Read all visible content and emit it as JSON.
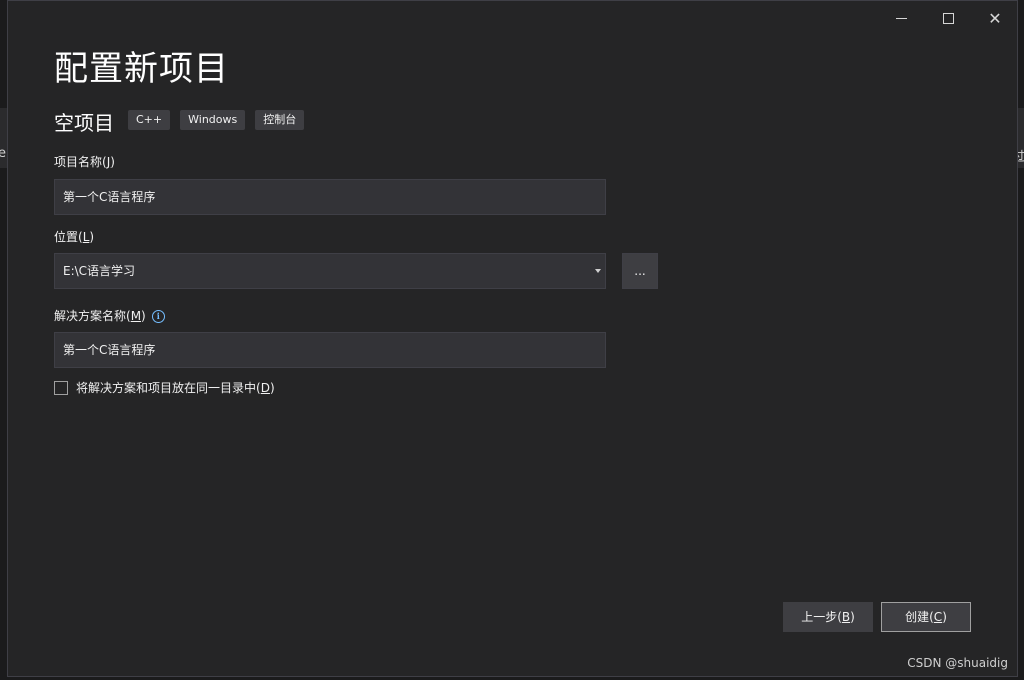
{
  "window": {
    "minimize_icon": "minimize-icon",
    "maximize_icon": "maximize-icon",
    "close_icon": "close-icon",
    "close_glyph": "✕"
  },
  "background": {
    "left_edge_char": "e",
    "right_edge_char": "过"
  },
  "header": {
    "title": "配置新项目",
    "subtitle": "空项目",
    "tags": [
      "C++",
      "Windows",
      "控制台"
    ]
  },
  "form": {
    "project_name": {
      "label_text": "项目名称(",
      "label_key": "J",
      "label_end": ")",
      "value": "第一个C语言程序"
    },
    "location": {
      "label_text": "位置(",
      "label_key": "L",
      "label_end": ")",
      "value": "E:\\C语言学习",
      "browse_label": "..."
    },
    "solution_name": {
      "label_text": "解决方案名称(",
      "label_key": "M",
      "label_end": ")",
      "info_glyph": "i",
      "value": "第一个C语言程序"
    },
    "same_dir": {
      "label_text": "将解决方案和项目放在同一目录中(",
      "label_key": "D",
      "label_end": ")",
      "checked": false
    }
  },
  "footer": {
    "back_text": "上一步(",
    "back_key": "B",
    "back_end": ")",
    "create_text": "创建(",
    "create_key": "C",
    "create_end": ")"
  },
  "watermark": "CSDN @shuaidig",
  "colors": {
    "dialog_bg": "#252526",
    "input_bg": "#333337",
    "button_bg": "#3e3e42",
    "info_accent": "#75beff"
  }
}
